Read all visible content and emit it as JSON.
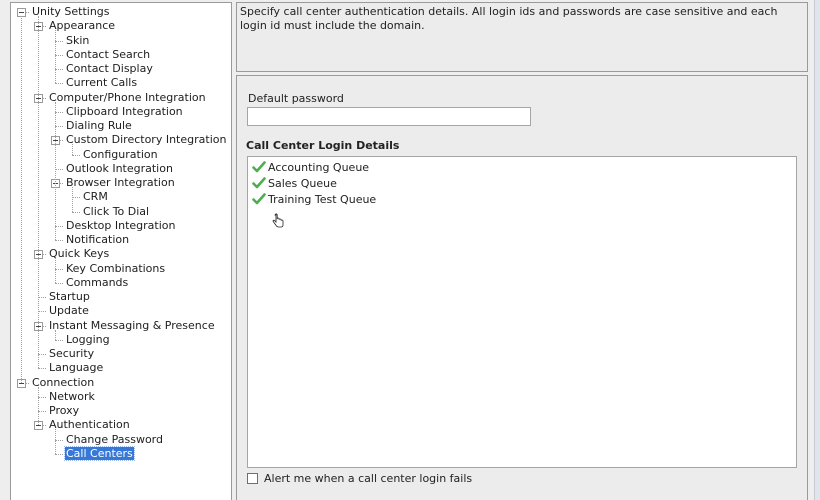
{
  "tree": {
    "items": [
      {
        "label": "Unity Settings",
        "level": 0,
        "expanded": true
      },
      {
        "label": "Appearance",
        "level": 1,
        "expanded": true
      },
      {
        "label": "Skin",
        "level": 2
      },
      {
        "label": "Contact Search",
        "level": 2
      },
      {
        "label": "Contact Display",
        "level": 2
      },
      {
        "label": "Current Calls",
        "level": 2
      },
      {
        "label": "Computer/Phone Integration",
        "level": 1,
        "expanded": true
      },
      {
        "label": "Clipboard Integration",
        "level": 2
      },
      {
        "label": "Dialing Rule",
        "level": 2
      },
      {
        "label": "Custom Directory Integration",
        "level": 2,
        "expanded": true
      },
      {
        "label": "Configuration",
        "level": 3
      },
      {
        "label": "Outlook Integration",
        "level": 2
      },
      {
        "label": "Browser Integration",
        "level": 2,
        "expanded": true
      },
      {
        "label": "CRM",
        "level": 3
      },
      {
        "label": "Click To Dial",
        "level": 3
      },
      {
        "label": "Desktop Integration",
        "level": 2
      },
      {
        "label": "Notification",
        "level": 2
      },
      {
        "label": "Quick Keys",
        "level": 1,
        "expanded": true
      },
      {
        "label": "Key Combinations",
        "level": 2
      },
      {
        "label": "Commands",
        "level": 2
      },
      {
        "label": "Startup",
        "level": 1
      },
      {
        "label": "Update",
        "level": 1
      },
      {
        "label": "Instant Messaging & Presence",
        "level": 1,
        "expanded": true
      },
      {
        "label": "Logging",
        "level": 2
      },
      {
        "label": "Security",
        "level": 1
      },
      {
        "label": "Language",
        "level": 1
      },
      {
        "label": "Connection",
        "level": 0,
        "expanded": true
      },
      {
        "label": "Network",
        "level": 1
      },
      {
        "label": "Proxy",
        "level": 1
      },
      {
        "label": "Authentication",
        "level": 1,
        "expanded": true
      },
      {
        "label": "Change Password",
        "level": 2
      },
      {
        "label": "Call Centers",
        "level": 2,
        "selected": true
      }
    ]
  },
  "description": "Specify call center authentication details.  All login ids and passwords are case sensitive and each login id must include the domain.",
  "form": {
    "default_password_label": "Default password",
    "default_password_value": "",
    "login_details_title": "Call Center Login Details",
    "queues": [
      {
        "name": "Accounting Queue",
        "status": "check-icon"
      },
      {
        "name": "Sales Queue",
        "status": "check-icon"
      },
      {
        "name": "Training Test Queue",
        "status": "check-icon"
      }
    ],
    "alert_label": "Alert me when a call center login fails",
    "alert_checked": false
  },
  "colors": {
    "selection": "#3778d6",
    "check": "#4caf50"
  }
}
